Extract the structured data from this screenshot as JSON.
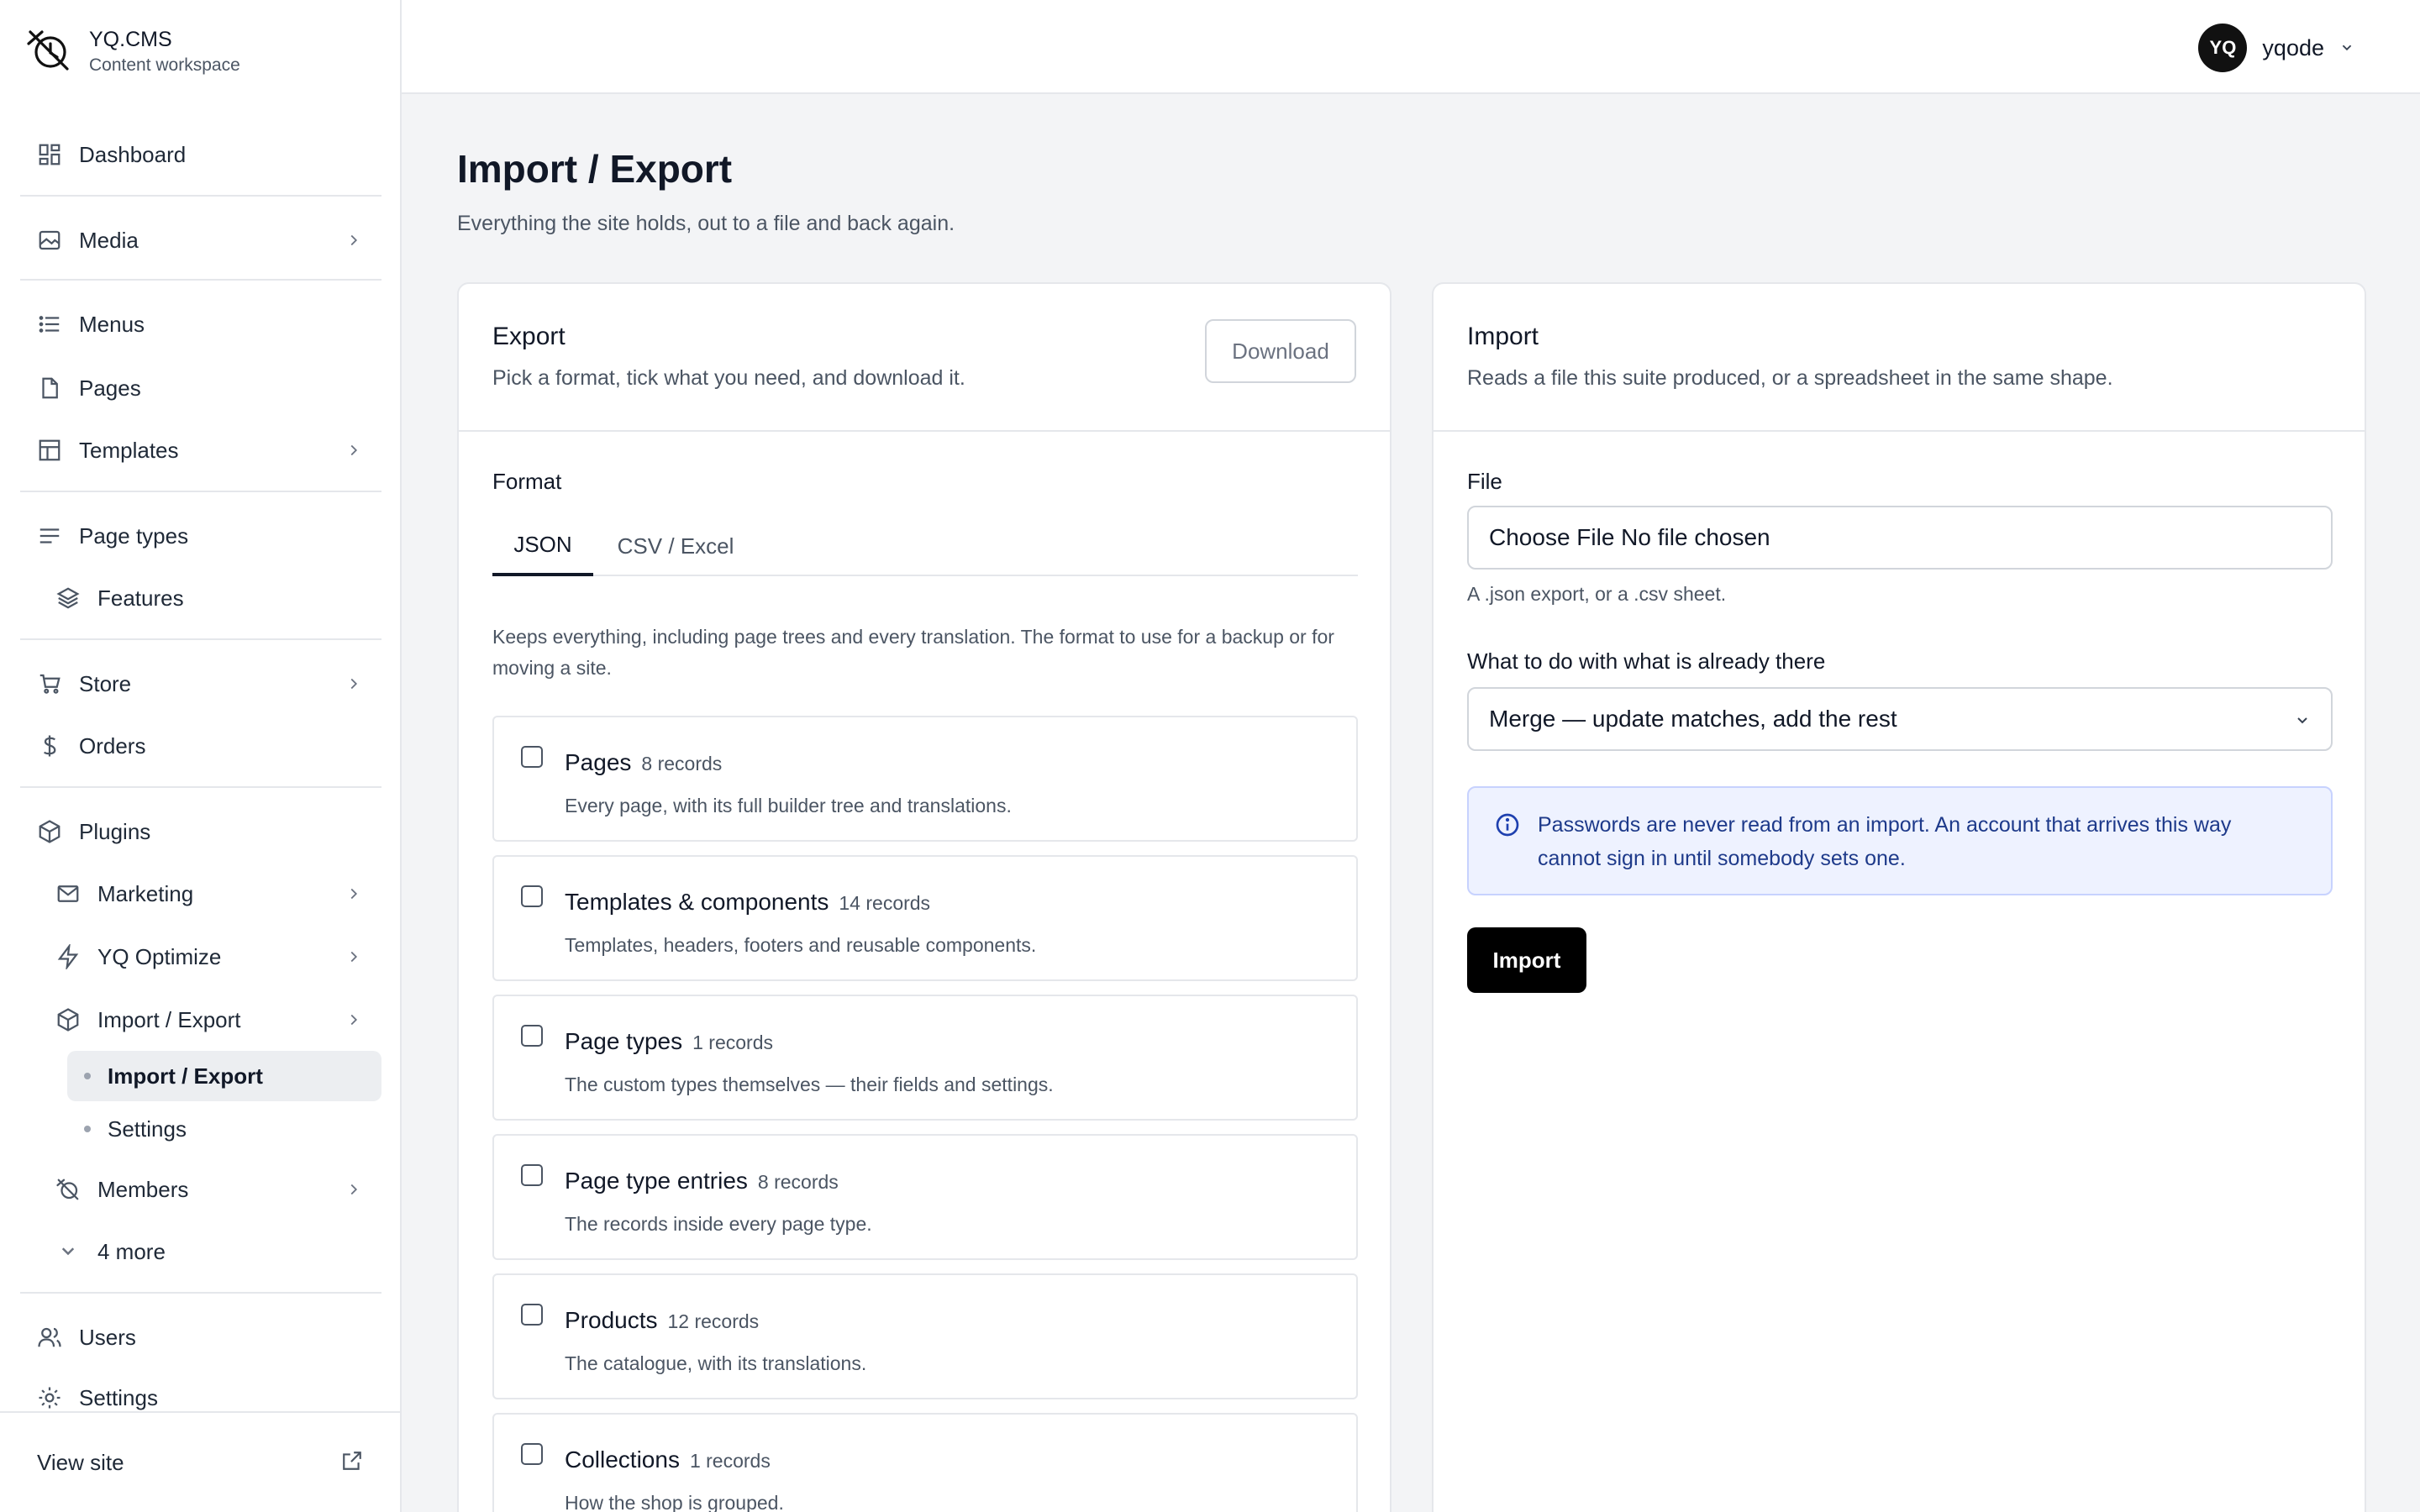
{
  "brand": {
    "name": "YQ.CMS",
    "subtitle": "Content workspace"
  },
  "sidebar": {
    "items": [
      {
        "label": "Dashboard",
        "icon": "dashboard-icon"
      },
      {
        "label": "Media",
        "icon": "image-icon"
      },
      {
        "label": "Menus",
        "icon": "list-icon"
      },
      {
        "label": "Pages",
        "icon": "file-icon"
      },
      {
        "label": "Templates",
        "icon": "layout-icon"
      },
      {
        "label": "Page types",
        "icon": "lines-icon"
      },
      {
        "label": "Features",
        "icon": "layers-icon"
      },
      {
        "label": "Store",
        "icon": "cart-icon"
      },
      {
        "label": "Orders",
        "icon": "dollar-icon"
      },
      {
        "label": "Plugins",
        "icon": "cube-icon"
      },
      {
        "label": "Marketing",
        "icon": "mail-icon"
      },
      {
        "label": "YQ Optimize",
        "icon": "bolt-icon"
      },
      {
        "label": "Import / Export",
        "icon": "cube-icon"
      },
      {
        "label": "Import / Export"
      },
      {
        "label": "Settings"
      },
      {
        "label": "Members",
        "icon": "members-icon"
      },
      {
        "label": "4 more",
        "icon": "chevron-down-icon"
      },
      {
        "label": "Users",
        "icon": "users-icon"
      },
      {
        "label": "Settings",
        "icon": "gear-icon"
      }
    ],
    "view_site": "View site"
  },
  "user": {
    "initials": "YQ",
    "name": "yqode"
  },
  "page": {
    "title": "Import / Export",
    "subtitle": "Everything the site holds, out to a file and back again."
  },
  "export": {
    "title": "Export",
    "description": "Pick a format, tick what you need, and download it.",
    "download_label": "Download",
    "format_label": "Format",
    "tabs": [
      "JSON",
      "CSV / Excel"
    ],
    "active_tab": "JSON",
    "format_description": "Keeps everything, including page trees and every translation. The format to use for a backup or for moving a site.",
    "records": [
      {
        "name": "Pages",
        "count": "8 records",
        "description": "Every page, with its full builder tree and translations.",
        "checked": false
      },
      {
        "name": "Templates & components",
        "count": "14 records",
        "description": "Templates, headers, footers and reusable components.",
        "checked": false
      },
      {
        "name": "Page types",
        "count": "1 records",
        "description": "The custom types themselves — their fields and settings.",
        "checked": false
      },
      {
        "name": "Page type entries",
        "count": "8 records",
        "description": "The records inside every page type.",
        "checked": false
      },
      {
        "name": "Products",
        "count": "12 records",
        "description": "The catalogue, with its translations.",
        "checked": false
      },
      {
        "name": "Collections",
        "count": "1 records",
        "description": "How the shop is grouped.",
        "checked": false
      }
    ]
  },
  "import": {
    "title": "Import",
    "description": "Reads a file this suite produced, or a spreadsheet in the same shape.",
    "file_label": "File",
    "file_value": "Choose File No file chosen",
    "file_hint": "A .json export, or a .csv sheet.",
    "mode_label": "What to do with what is already there",
    "mode_value": "Merge — update matches, add the rest",
    "notice": "Passwords are never read from an import. An account that arrives this way cannot sign in until somebody sets one.",
    "import_label": "Import"
  },
  "colors": {
    "accent": "#000000",
    "notice_bg": "#eef2ff",
    "notice_text": "#1e3a8a"
  }
}
